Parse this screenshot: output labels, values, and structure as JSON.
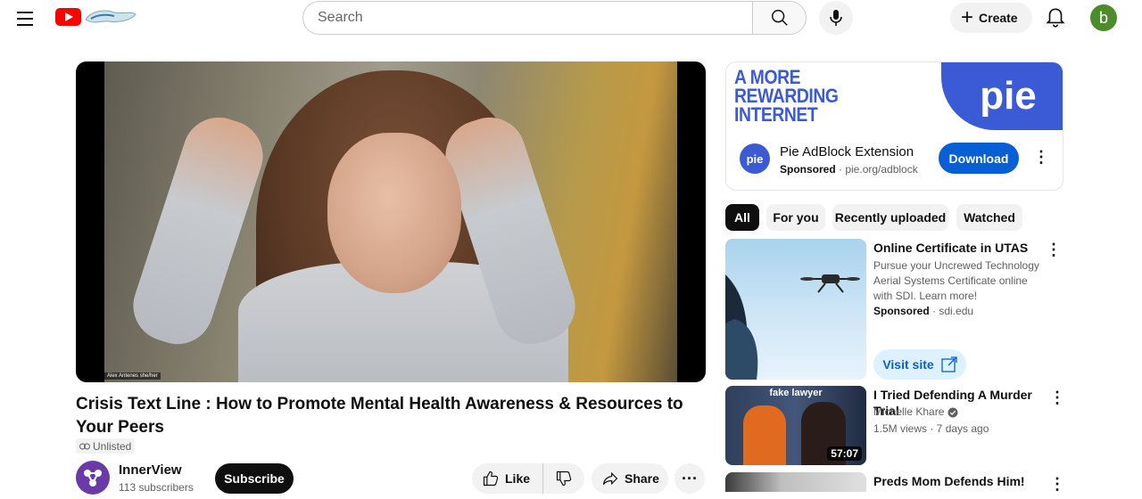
{
  "header": {
    "search_placeholder": "Search",
    "create_label": "Create",
    "avatar_letter": "b",
    "brand_color": "#ff0000"
  },
  "video": {
    "title": "Crisis Text Line : How to Promote Mental Health Awareness & Resources to Your Peers",
    "overlay_name": "Alex Antenes she/her",
    "visibility": "Unlisted",
    "channel_name": "InnerView",
    "channel_subs": "113 subscribers",
    "subscribe_label": "Subscribe",
    "like_label": "Like",
    "share_label": "Share",
    "more_label": "···"
  },
  "ad": {
    "headline_lines": [
      "A MORE",
      "REWARDING",
      "INTERNET"
    ],
    "logo_text": "pie",
    "name": "Pie AdBlock Extension",
    "sponsored": "Sponsored",
    "domain": "pie.org/adblock",
    "cta": "Download",
    "accent": "#3b5bd6"
  },
  "chips": [
    "All",
    "For you",
    "Recently uploaded",
    "Watched"
  ],
  "recommendations": [
    {
      "title": "Online Certificate in UTAS",
      "description": "Pursue your Uncrewed Technology Aerial Systems Certificate online with SDI. Learn more!",
      "sponsored": "Sponsored",
      "domain": "sdi.edu",
      "cta": "Visit site"
    },
    {
      "title": "I Tried Defending A Murder Trial",
      "channel": "Michelle Khare",
      "meta": "1.5M views · 7 days ago",
      "thumb_text": "fake lawyer",
      "duration": "57:07"
    },
    {
      "title": "Preds Mom Defends Him!"
    }
  ]
}
